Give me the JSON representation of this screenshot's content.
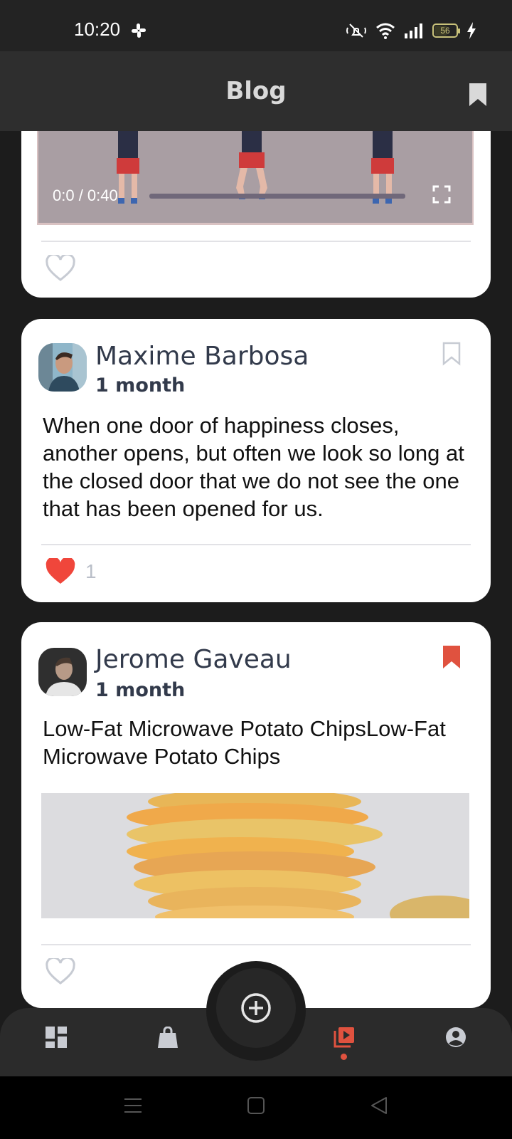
{
  "status_bar": {
    "time": "10:20",
    "battery_level": "56",
    "icons": [
      "slack-icon",
      "mute-icon",
      "wifi-icon",
      "signal-icon",
      "battery-icon",
      "charging-icon"
    ]
  },
  "app_bar": {
    "title": "Blog",
    "bookmark_icon": "bookmark-icon"
  },
  "posts": [
    {
      "type": "video",
      "video_time": "0:0 / 0:40",
      "progress": 0,
      "liked": false,
      "like_icon": "heart-outline-icon"
    },
    {
      "author": "Maxime Barbosa",
      "time": "1 month",
      "text": "When one door of happiness closes, another opens, but often we look so long at the closed door that we do not see the one that has been opened for us.",
      "liked": true,
      "like_count": "1",
      "bookmarked": false,
      "colors": {
        "like": "#f0463b",
        "bookmark": "#c7cbd3"
      }
    },
    {
      "author": "Jerome Gaveau",
      "time": "1 month",
      "text": "Low-Fat Microwave Potato ChipsLow-Fat Microwave Potato Chips",
      "liked": false,
      "bookmarked": true,
      "colors": {
        "like": "#c7cbd3",
        "bookmark": "#e0523f"
      }
    }
  ],
  "bottom_nav": {
    "items": [
      "dashboard-icon",
      "shopping-bag-icon",
      "video-library-icon",
      "account-icon"
    ],
    "active": "video-library-icon",
    "fab_icon": "add-circle-icon",
    "accent": "#e0523f"
  },
  "system_nav": [
    "menu-icon",
    "home-icon",
    "back-icon"
  ]
}
